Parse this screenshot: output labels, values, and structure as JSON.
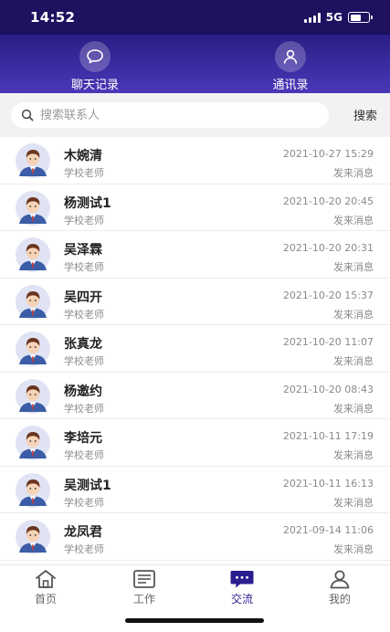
{
  "status_bar": {
    "time": "14:52",
    "network": "5G"
  },
  "top_nav": {
    "tabs": [
      {
        "label": "聊天记录",
        "icon": "chat-bubble-icon"
      },
      {
        "label": "通讯录",
        "icon": "contact-person-icon"
      }
    ]
  },
  "search": {
    "placeholder": "搜索联系人",
    "value": "",
    "button_label": "搜索"
  },
  "contacts": [
    {
      "name": "木婉清",
      "role": "学校老师",
      "time": "2021-10-27 15:29",
      "status": "发来消息"
    },
    {
      "name": "杨测试1",
      "role": "学校老师",
      "time": "2021-10-20 20:45",
      "status": "发来消息"
    },
    {
      "name": "吴泽霖",
      "role": "学校老师",
      "time": "2021-10-20 20:31",
      "status": "发来消息"
    },
    {
      "name": "吴四开",
      "role": "学校老师",
      "time": "2021-10-20 15:37",
      "status": "发来消息"
    },
    {
      "name": "张真龙",
      "role": "学校老师",
      "time": "2021-10-20 11:07",
      "status": "发来消息"
    },
    {
      "name": "杨邀约",
      "role": "学校老师",
      "time": "2021-10-20 08:43",
      "status": "发来消息"
    },
    {
      "name": "李培元",
      "role": "学校老师",
      "time": "2021-10-11 17:19",
      "status": "发来消息"
    },
    {
      "name": "吴测试1",
      "role": "学校老师",
      "time": "2021-10-11 16:13",
      "status": "发来消息"
    },
    {
      "name": "龙凤君",
      "role": "学校老师",
      "time": "2021-09-14 11:06",
      "status": "发来消息"
    }
  ],
  "tab_bar": {
    "tabs": [
      {
        "label": "首页",
        "icon": "home-icon",
        "active": false
      },
      {
        "label": "工作",
        "icon": "work-list-icon",
        "active": false
      },
      {
        "label": "交流",
        "icon": "chat-message-icon",
        "active": true
      },
      {
        "label": "我的",
        "icon": "profile-icon",
        "active": false
      }
    ]
  },
  "colors": {
    "brand_dark": "#1d1160",
    "brand": "#4a38b8",
    "active_tab": "#2a1e8f"
  }
}
